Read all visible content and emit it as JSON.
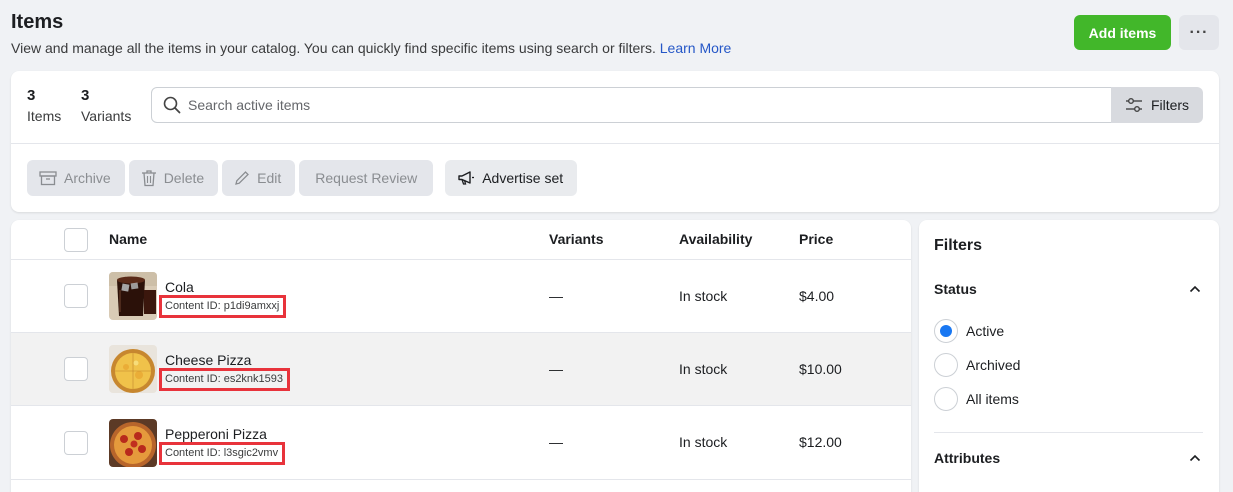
{
  "header": {
    "title": "Items",
    "subtitle": "View and manage all the items in your catalog. You can quickly find specific items using search or filters.",
    "learn_more": "Learn More",
    "add_label": "Add items",
    "more_label": "···"
  },
  "summary": {
    "items_count": "3",
    "items_label": "Items",
    "variants_count": "3",
    "variants_label": "Variants"
  },
  "search": {
    "placeholder": "Search active items",
    "value": "",
    "filters_label": "Filters"
  },
  "actions": {
    "archive": "Archive",
    "delete": "Delete",
    "edit": "Edit",
    "request_review": "Request Review",
    "advertise_set": "Advertise set"
  },
  "table": {
    "columns": {
      "name": "Name",
      "variants": "Variants",
      "availability": "Availability",
      "price": "Price"
    },
    "rows": [
      {
        "name": "Cola",
        "content_id": "Content ID: p1di9amxxj",
        "variants": "—",
        "availability": "In stock",
        "price": "$4.00",
        "thumb": "cola"
      },
      {
        "name": "Cheese Pizza",
        "content_id": "Content ID: es2knk1593",
        "variants": "—",
        "availability": "In stock",
        "price": "$10.00",
        "thumb": "cheese-pizza"
      },
      {
        "name": "Pepperoni Pizza",
        "content_id": "Content ID: l3sgic2vmv",
        "variants": "—",
        "availability": "In stock",
        "price": "$12.00",
        "thumb": "pepperoni-pizza"
      }
    ]
  },
  "sidebar": {
    "title": "Filters",
    "status_label": "Status",
    "status_options": [
      "Active",
      "Archived",
      "All items"
    ],
    "status_selected": "Active",
    "attributes_label": "Attributes"
  },
  "colors": {
    "accent_green": "#42b72a",
    "link_blue": "#2557c7",
    "radio_blue": "#1877f2",
    "highlight_red": "#e8333b"
  }
}
